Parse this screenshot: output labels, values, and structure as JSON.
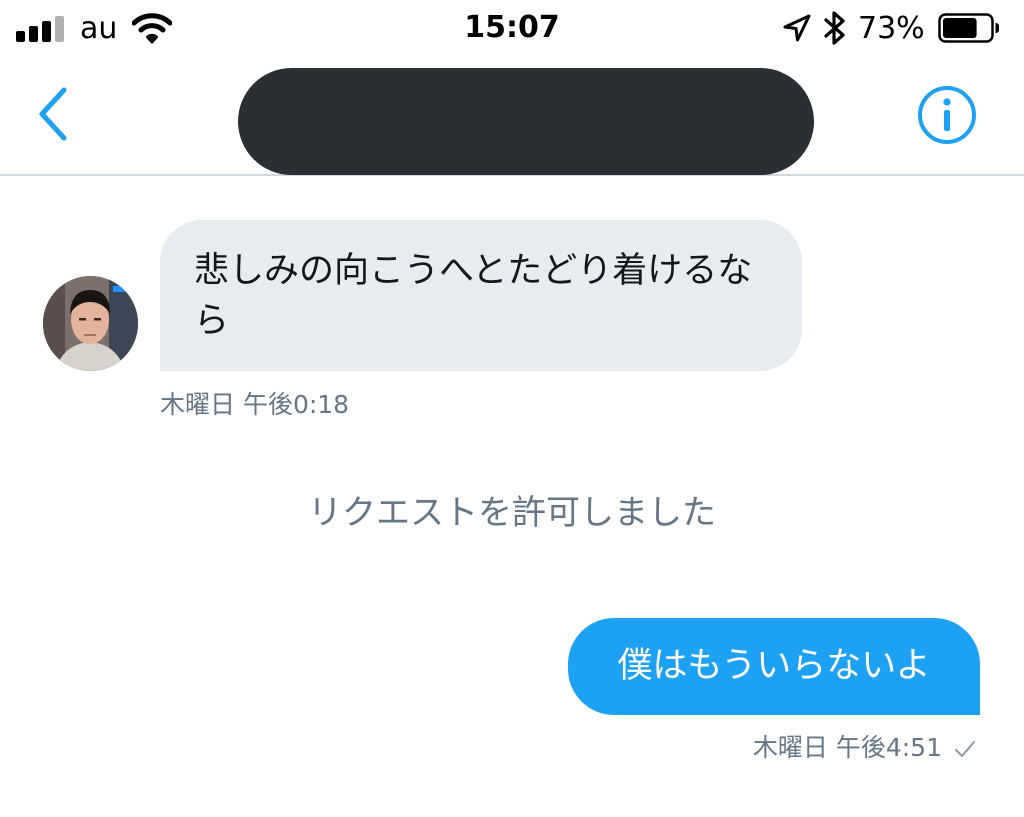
{
  "status_bar": {
    "carrier": "au",
    "time": "15:07",
    "battery_percent": "73%",
    "battery_level": 0.73,
    "icons": [
      "signal-icon",
      "wifi-icon",
      "location-arrow-icon",
      "bluetooth-icon",
      "battery-icon"
    ]
  },
  "header": {
    "back_icon": "chevron-left-icon",
    "info_icon": "info-icon",
    "accent_color": "#1da1f2"
  },
  "messages": [
    {
      "direction": "incoming",
      "text": "悲しみの向こうへとたどり着けるなら",
      "timestamp": "木曜日 午後0:18"
    },
    {
      "direction": "system",
      "text": "リクエストを許可しました"
    },
    {
      "direction": "outgoing",
      "text": "僕はもういらないよ",
      "timestamp": "木曜日 午後4:51",
      "status_icon": "check-icon"
    }
  ],
  "colors": {
    "incoming_bubble": "#e6ecf0",
    "outgoing_bubble": "#1da1f2",
    "secondary_text": "#657786",
    "title_redaction": "#292f33"
  }
}
